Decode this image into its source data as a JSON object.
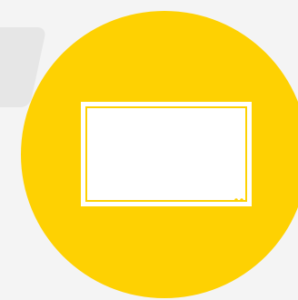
{
  "colors": {
    "background": "#f4f4f4",
    "side_panel": "#e6e6e6",
    "badge": "#fed102",
    "icon": "#ffffff"
  },
  "icon": {
    "name": "tv-icon"
  }
}
